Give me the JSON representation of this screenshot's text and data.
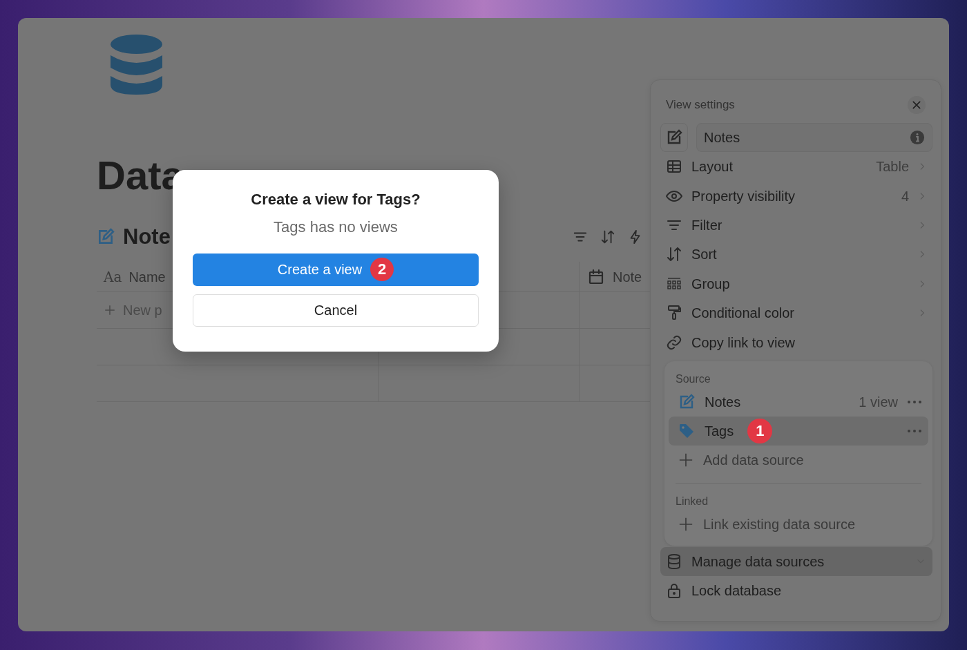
{
  "page": {
    "title": "Data",
    "database_title": "Note",
    "columns": [
      {
        "type_glyph": "Aa",
        "label": "Name"
      },
      {
        "label": "Note"
      }
    ],
    "new_row": "New p"
  },
  "view_settings": {
    "title": "View settings",
    "view_name": "Notes",
    "items": [
      {
        "label": "Layout",
        "value": "Table",
        "kind": "submenu"
      },
      {
        "label": "Property visibility",
        "value": "4",
        "kind": "submenu"
      },
      {
        "label": "Filter",
        "kind": "submenu"
      },
      {
        "label": "Sort",
        "kind": "submenu"
      },
      {
        "label": "Group",
        "kind": "submenu"
      },
      {
        "label": "Conditional color",
        "kind": "submenu"
      },
      {
        "label": "Copy link to view",
        "kind": "action"
      }
    ],
    "source": {
      "heading": "Source",
      "items": [
        {
          "label": "Notes",
          "count": "1 view",
          "selected": false
        },
        {
          "label": "Tags",
          "badge": "1",
          "selected": true
        }
      ],
      "add": "Add data source"
    },
    "linked": {
      "heading": "Linked",
      "add": "Link existing data source"
    },
    "footer": [
      {
        "label": "Manage data sources",
        "kind": "dropdown",
        "selected": true
      },
      {
        "label": "Lock database",
        "kind": "action",
        "selected": false
      }
    ]
  },
  "dialog": {
    "title": "Create a view for Tags?",
    "message": "Tags has no views",
    "primary": "Create a view",
    "primary_badge": "2",
    "cancel": "Cancel"
  }
}
